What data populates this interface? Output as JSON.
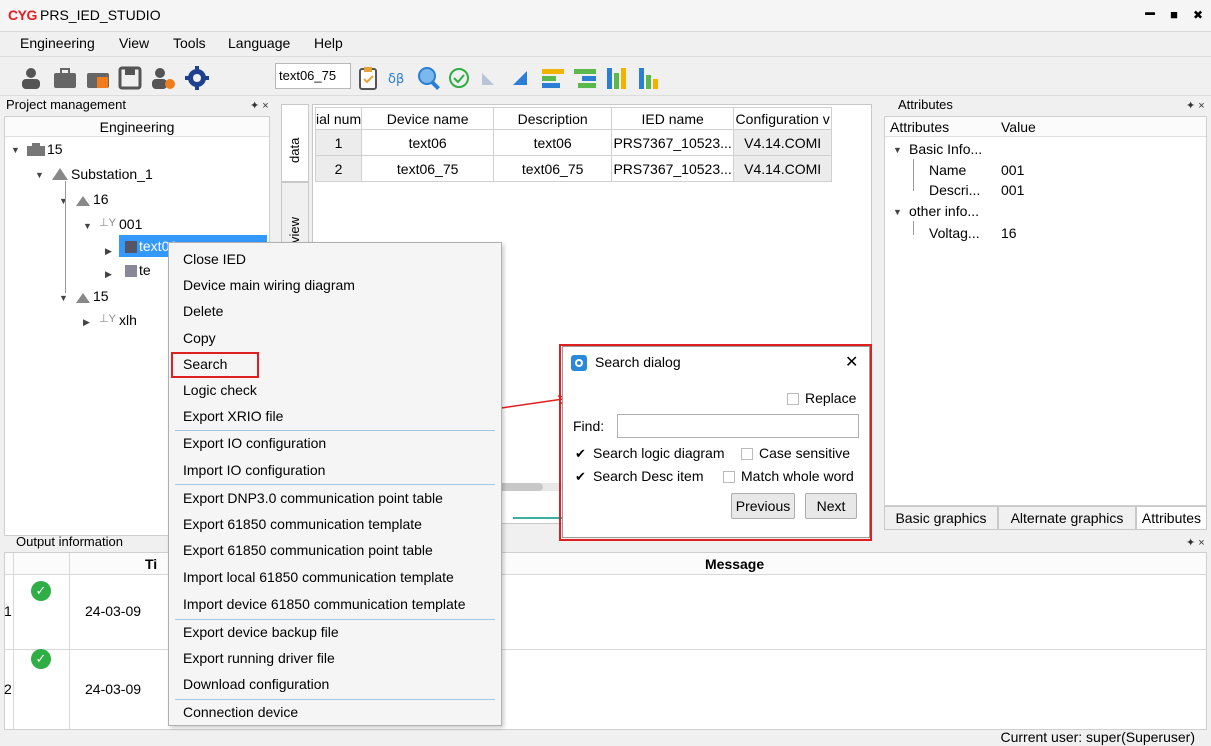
{
  "app": {
    "logo": "CYG",
    "title": "PRS_IED_STUDIO"
  },
  "window_controls": {
    "minimize": "━",
    "maximize": "■",
    "close": "✖"
  },
  "menubar": [
    "Engineering",
    "View",
    "Tools",
    "Language",
    "Help"
  ],
  "toolbar": {
    "selected_device": "text06_75",
    "icons": [
      "user-icon",
      "briefcase-icon",
      "toolbox-icon",
      "save-icon",
      "user-settings-icon",
      "gear-icon",
      "clipboard-icon",
      "balance-icon",
      "search-icon",
      "check-circle-icon",
      "arrow-back-icon",
      "arrow-forward-icon",
      "align-left-icon",
      "align-right-icon",
      "bar-chart-icon",
      "column-chart-icon"
    ]
  },
  "project_panel": {
    "title": "Project management",
    "column_header": "Engineering",
    "tree": [
      {
        "label": "15"
      },
      {
        "label": "Substation_1"
      },
      {
        "label": "16"
      },
      {
        "label": "001"
      },
      {
        "label": "text06"
      },
      {
        "label": "te"
      },
      {
        "label": "15"
      },
      {
        "label": "xlh"
      }
    ]
  },
  "side_tabs": [
    "data",
    "view"
  ],
  "grid": {
    "columns": [
      "ial num",
      "Device name",
      "Description",
      "IED name",
      "Configuration v"
    ],
    "rows": [
      [
        "1",
        "text06",
        "text06",
        "PRS7367_10523...",
        "V4.14.COMI"
      ],
      [
        "2",
        "text06_75",
        "text06_75",
        "PRS7367_10523...",
        "V4.14.COMI"
      ]
    ]
  },
  "attributes_panel": {
    "title": "Attributes",
    "col_attr": "Attributes",
    "col_value": "Value",
    "groups": [
      {
        "name": "Basic Info...",
        "items": [
          {
            "k": "Name",
            "v": "001"
          },
          {
            "k": "Descri...",
            "v": "001"
          }
        ]
      },
      {
        "name": "other info...",
        "items": [
          {
            "k": "Voltag...",
            "v": "16"
          }
        ]
      }
    ],
    "bottom_tabs": [
      "Basic graphics",
      "Alternate graphics",
      "Attributes"
    ]
  },
  "output_panel": {
    "title": "Output information",
    "col_time": "Ti",
    "col_message": "Message",
    "rows": [
      {
        "index": "1",
        "time": "24-03-09"
      },
      {
        "index": "2",
        "time": "24-03-09"
      }
    ]
  },
  "context_menu": {
    "items": [
      "Close IED",
      "Device main wiring diagram",
      "Delete",
      "Copy",
      "Search",
      "Logic check",
      "Export XRIO file",
      "Export IO configuration",
      "Import IO configuration",
      "Export DNP3.0 communication point table",
      "Export 61850 communication template",
      "Export 61850 communication point table",
      "Import local 61850 communication template",
      "Import device 61850 communication template",
      "Export device backup file",
      "Export running driver file",
      "Download configuration",
      "Connection device"
    ]
  },
  "search_dialog": {
    "title": "Search dialog",
    "close": "✕",
    "replace_label": "Replace",
    "find_label": "Find:",
    "find_value": "",
    "opt_logic": "Search logic diagram",
    "opt_case": "Case sensitive",
    "opt_desc": "Search Desc item",
    "opt_whole": "Match whole word",
    "logic_checked": true,
    "case_checked": false,
    "desc_checked": true,
    "whole_checked": false,
    "replace_checked": false,
    "prev_label": "Previous",
    "next_label": "Next"
  },
  "status": {
    "user": "Current user: super(Superuser)"
  },
  "colors": {
    "highlight": "#e02020",
    "selection": "#3399ff",
    "check": "#2fae46"
  }
}
